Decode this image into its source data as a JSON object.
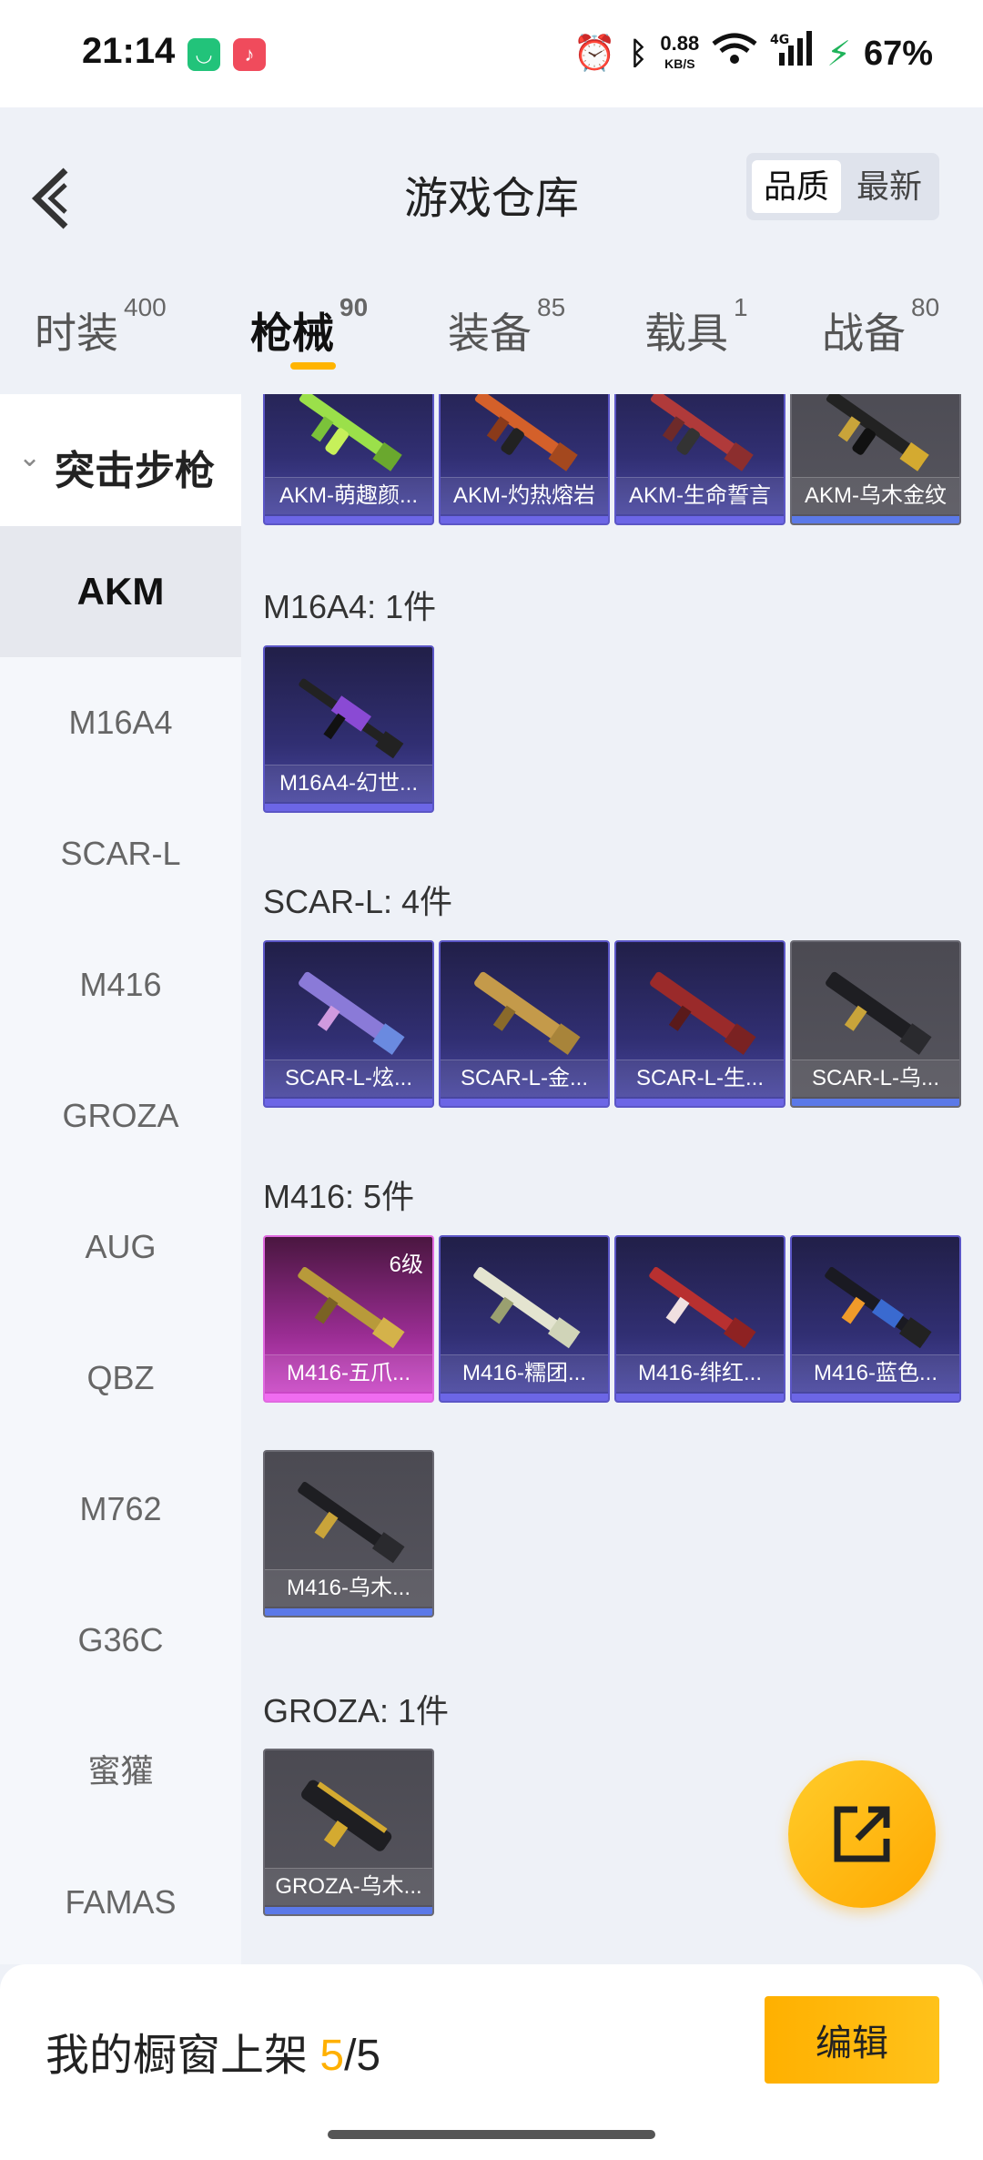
{
  "status_bar": {
    "time": "21:14",
    "net_speed_value": "0.88",
    "net_speed_unit": "KB/S",
    "signal": "4G",
    "battery": "67%",
    "icons": [
      "mi-app-icon",
      "music-app-icon",
      "alarm-icon",
      "bluetooth-icon",
      "wifi-icon",
      "signal-icon",
      "battery-charging-icon"
    ]
  },
  "header": {
    "title": "游戏仓库",
    "sort_quality": "品质",
    "sort_latest": "最新"
  },
  "tabs": [
    {
      "label": "时装",
      "count": "400"
    },
    {
      "label": "枪械",
      "count": "90",
      "active": true
    },
    {
      "label": "装备",
      "count": "85"
    },
    {
      "label": "载具",
      "count": "1"
    },
    {
      "label": "战备",
      "count": "80"
    }
  ],
  "sidebar": {
    "group": "突击步枪",
    "items": [
      "AKM",
      "M16A4",
      "SCAR-L",
      "M416",
      "GROZA",
      "AUG",
      "QBZ",
      "M762",
      "G36C",
      "蜜獾",
      "FAMAS"
    ],
    "active": "AKM"
  },
  "sections": {
    "akm": {
      "items": [
        "AKM-萌趣颜...",
        "AKM-灼热熔岩",
        "AKM-生命誓言",
        "AKM-乌木金纹"
      ]
    },
    "m16a4": {
      "label": "M16A4: 1件",
      "items": [
        "M16A4-幻世..."
      ]
    },
    "scarl": {
      "label": "SCAR-L: 4件",
      "items": [
        "SCAR-L-炫...",
        "SCAR-L-金...",
        "SCAR-L-生...",
        "SCAR-L-乌..."
      ]
    },
    "m416": {
      "label": "M416: 5件",
      "level": "6级",
      "items": [
        "M416-五爪...",
        "M416-糯团...",
        "M416-绯红...",
        "M416-蓝色...",
        "M416-乌木..."
      ]
    },
    "groza": {
      "label": "GROZA: 1件",
      "items": [
        "GROZA-乌木..."
      ]
    }
  },
  "bottom": {
    "label": "我的橱窗上架",
    "count": "5",
    "total": "/5",
    "edit": "编辑"
  },
  "colors": {
    "accent": "#ffb400",
    "rare_purple": "#5b56c6",
    "legend_pink": "#e06ae0",
    "common_gray": "#56555e"
  }
}
